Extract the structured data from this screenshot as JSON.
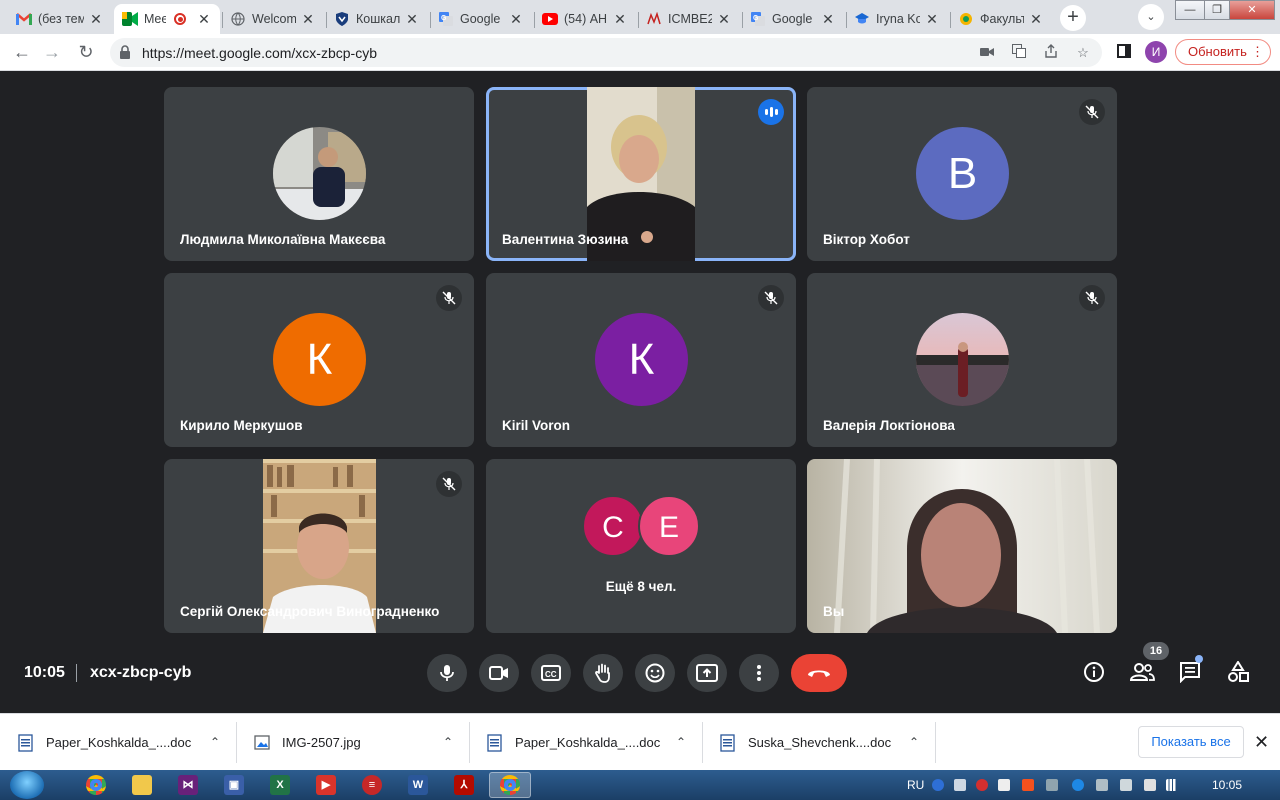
{
  "browser": {
    "tabs": [
      {
        "title": "(без темы)",
        "icon": "gmail-icon",
        "active": false
      },
      {
        "title": "Meet",
        "icon": "meet-icon",
        "active": true
      },
      {
        "title": "Welcome",
        "icon": "globe-icon",
        "active": false
      },
      {
        "title": "Кошкалда",
        "icon": "shield-icon",
        "active": false
      },
      {
        "title": "Google",
        "icon": "google-translate-icon",
        "active": false
      },
      {
        "title": "(54) АН",
        "icon": "youtube-icon",
        "active": false
      },
      {
        "title": "ICMBE2",
        "icon": "site-icon",
        "active": false
      },
      {
        "title": "Google",
        "icon": "google-translate-icon",
        "active": false
      },
      {
        "title": "Iryna Ko",
        "icon": "classroom-icon",
        "active": false
      },
      {
        "title": "Факульт",
        "icon": "site-icon",
        "active": false
      }
    ],
    "url": "https://meet.google.com/xcx-zbcp-cyb",
    "profile_initial": "И",
    "update_label": "Обновить"
  },
  "meet": {
    "participants": [
      {
        "name": "Людмила Миколаївна Макєєва",
        "type": "photo",
        "muted": false
      },
      {
        "name": "Валентина Зюзина",
        "type": "video",
        "speaking": true
      },
      {
        "name": "Віктор Хобот",
        "type": "letter",
        "letter": "В",
        "color": "#5c6bc0",
        "muted": true
      },
      {
        "name": "Кирило Меркушов",
        "type": "letter",
        "letter": "К",
        "color": "#ef6c00",
        "muted": true
      },
      {
        "name": "Kiril Voron",
        "type": "letter",
        "letter": "К",
        "color": "#7b1fa2",
        "muted": true
      },
      {
        "name": "Валерія Локтіонова",
        "type": "photo",
        "muted": true
      },
      {
        "name": "Сергій Олександрович Виноградненко",
        "type": "video",
        "muted": true
      },
      {
        "name": "Вы",
        "type": "video",
        "muted": false
      }
    ],
    "more": {
      "letters": [
        "С",
        "Е"
      ],
      "colors": [
        "#c2185b",
        "#e8457a"
      ],
      "label": "Ещё 8 чел."
    },
    "time": "10:05",
    "meeting_code": "xcx-zbcp-cyb",
    "participant_count": "16"
  },
  "downloads": {
    "items": [
      {
        "name": "Paper_Koshkalda_....doc",
        "icon": "word-doc-icon"
      },
      {
        "name": "IMG-2507.jpg",
        "icon": "image-file-icon"
      },
      {
        "name": "Paper_Koshkalda_....doc",
        "icon": "word-doc-icon"
      },
      {
        "name": "Suska_Shevchenk....doc",
        "icon": "word-doc-icon"
      }
    ],
    "show_all": "Показать все"
  },
  "taskbar": {
    "language": "RU",
    "clock": "10:05"
  }
}
